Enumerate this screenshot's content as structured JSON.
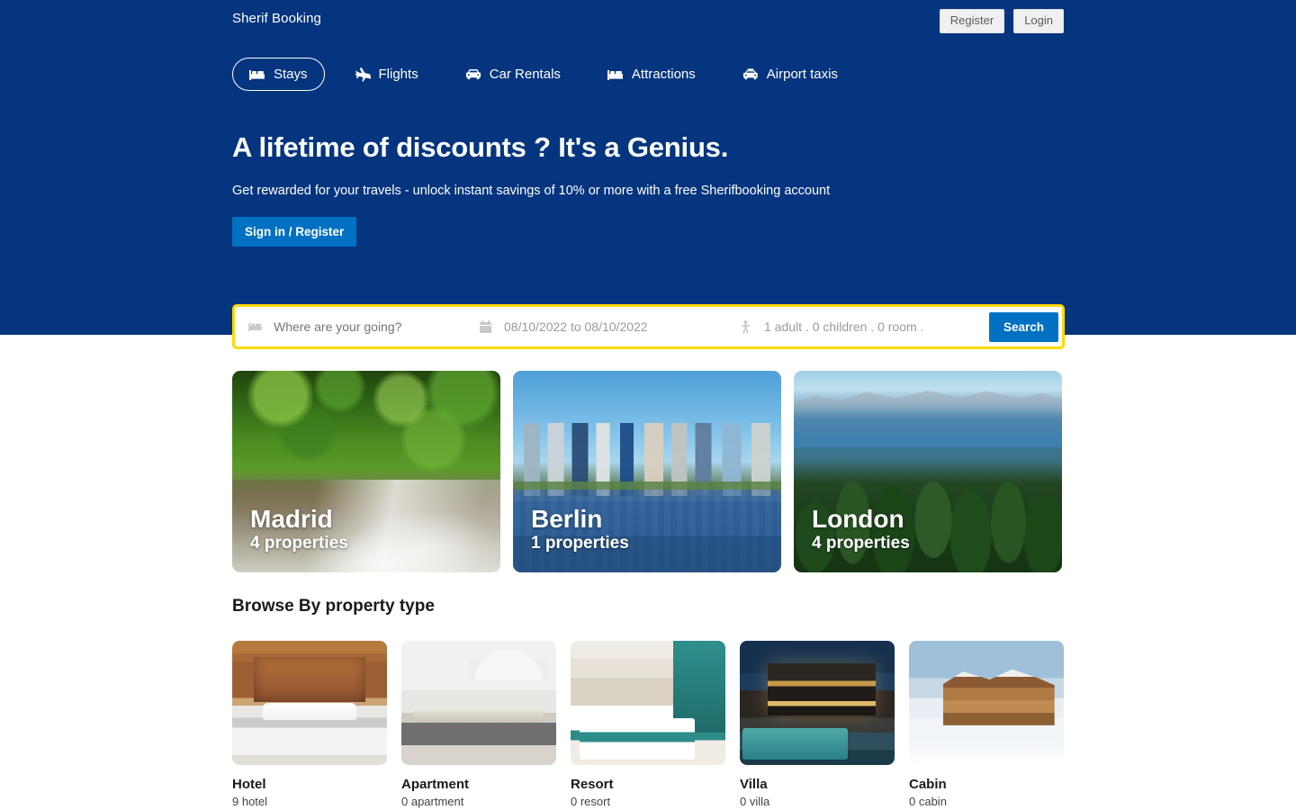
{
  "header": {
    "brand": "Sherif Booking",
    "register_label": "Register",
    "login_label": "Login"
  },
  "nav": {
    "items": [
      {
        "label": "Stays",
        "icon": "bed-icon",
        "active": true
      },
      {
        "label": "Flights",
        "icon": "plane-icon",
        "active": false
      },
      {
        "label": "Car Rentals",
        "icon": "car-icon",
        "active": false
      },
      {
        "label": "Attractions",
        "icon": "bed-icon",
        "active": false
      },
      {
        "label": "Airport taxis",
        "icon": "taxi-icon",
        "active": false
      }
    ]
  },
  "hero": {
    "title": "A lifetime of discounts ? It's a Genius.",
    "subtitle": "Get rewarded for your travels - unlock instant savings of 10% or more with a free Sherifbooking account",
    "cta_label": "Sign in / Register"
  },
  "search": {
    "destination_placeholder": "Where are your going?",
    "dates_value": "08/10/2022 to 08/10/2022",
    "guests_value": "1 adult . 0 children . 0 room .",
    "search_label": "Search",
    "border_color": "#ffd901",
    "button_color": "#0071c2"
  },
  "cities": [
    {
      "name": "Madrid",
      "count": "4 properties",
      "image": "forest-waterfall-photo"
    },
    {
      "name": "Berlin",
      "count": "1 properties",
      "image": "city-skyline-lake-photo"
    },
    {
      "name": "London",
      "count": "4 properties",
      "image": "lake-pine-forest-photo"
    }
  ],
  "browse": {
    "title": "Browse By property type",
    "types": [
      {
        "name": "Hotel",
        "count": "9 hotel",
        "image": "hotel-bedroom-photo"
      },
      {
        "name": "Apartment",
        "count": "0 apartment",
        "image": "apartment-kitchen-photo"
      },
      {
        "name": "Resort",
        "count": "0 resort",
        "image": "resort-room-photo"
      },
      {
        "name": "Villa",
        "count": "0 villa",
        "image": "villa-pool-night-photo"
      },
      {
        "name": "Cabin",
        "count": "0 cabin",
        "image": "snow-cabin-photo"
      }
    ]
  },
  "theme": {
    "header_blue": "#05357e",
    "accent_blue": "#0071c2",
    "accent_yellow": "#ffd901"
  }
}
